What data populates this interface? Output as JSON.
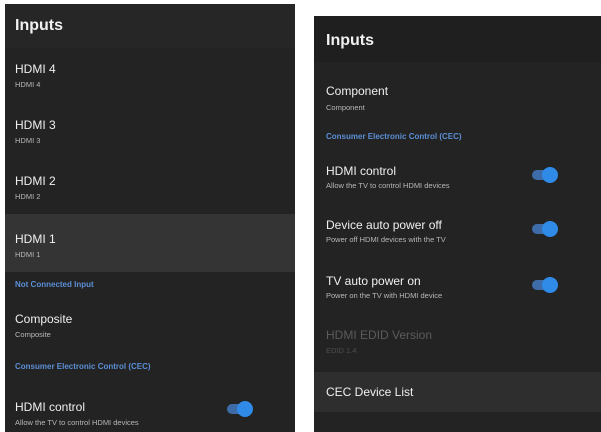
{
  "left_panel": {
    "title": "Inputs",
    "rows": [
      {
        "title": "HDMI 4",
        "sub": "HDMI 4"
      },
      {
        "title": "HDMI 3",
        "sub": "HDMI 3"
      },
      {
        "title": "HDMI 2",
        "sub": "HDMI 2"
      },
      {
        "title": "HDMI 1",
        "sub": "HDMI 1"
      }
    ],
    "section_not_connected": "Not Connected Input",
    "composite": {
      "title": "Composite",
      "sub": "Composite"
    },
    "section_cec": "Consumer Electronic Control (CEC)",
    "hdmi_control": {
      "title": "HDMI control",
      "sub": "Allow the TV to control HDMI devices",
      "enabled": true
    }
  },
  "right_panel": {
    "title": "Inputs",
    "component": {
      "title": "Component",
      "sub": "Component"
    },
    "section_cec": "Consumer Electronic Control (CEC)",
    "hdmi_control": {
      "title": "HDMI control",
      "sub": "Allow the TV to control HDMI devices",
      "enabled": true
    },
    "device_auto_power_off": {
      "title": "Device auto power off",
      "sub": "Power off HDMI devices with the TV",
      "enabled": true
    },
    "tv_auto_power_on": {
      "title": "TV auto power on",
      "sub": "Power on the TV with HDMI device",
      "enabled": true
    },
    "edid": {
      "title": "HDMI EDID Version",
      "sub": "EDID 1.4"
    },
    "cec_device_list": "CEC Device List"
  },
  "colors": {
    "background": "#232323",
    "accent": "#2f8ae8",
    "section_label": "#5b8fd6"
  }
}
